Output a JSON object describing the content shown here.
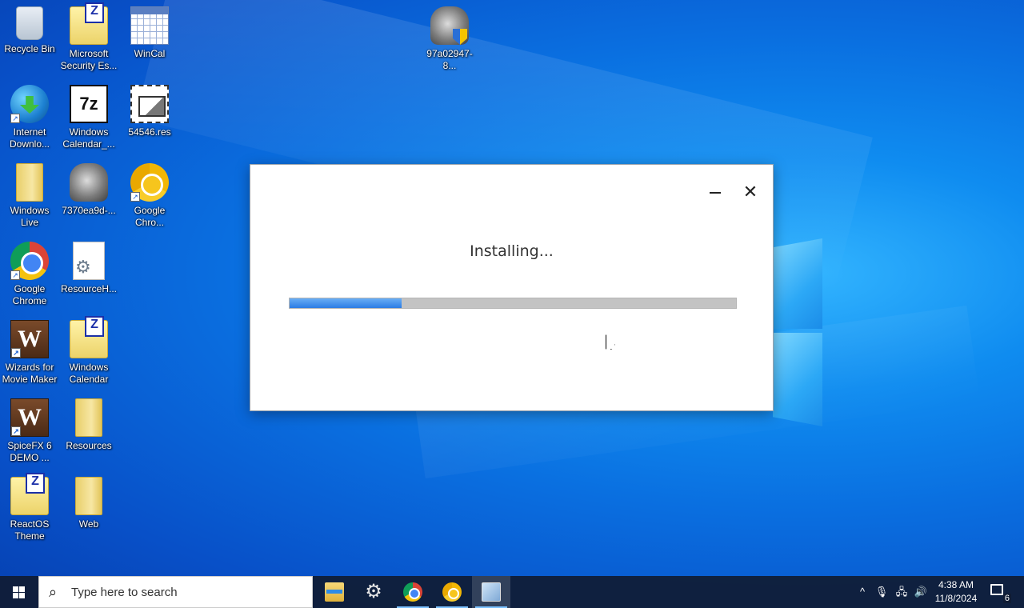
{
  "desktop": {
    "icons": [
      {
        "label": "Recycle Bin"
      },
      {
        "label": "Microsoft Security Es..."
      },
      {
        "label": "WinCal"
      },
      {
        "label": "97a02947-8..."
      },
      {
        "label": "Internet Downlo..."
      },
      {
        "label": "Windows Calendar_..."
      },
      {
        "label": "54546.res"
      },
      {
        "label": "Windows Live"
      },
      {
        "label": "7370ea9d-..."
      },
      {
        "label": "Google Chro..."
      },
      {
        "label": "Google Chrome"
      },
      {
        "label": "ResourceH..."
      },
      {
        "label": "Wizards for Movie Maker"
      },
      {
        "label": "Windows Calendar"
      },
      {
        "label": "SpiceFX 6 DEMO ..."
      },
      {
        "label": "Resources"
      },
      {
        "label": "ReactOS Theme"
      },
      {
        "label": "Web"
      }
    ]
  },
  "installer": {
    "status_text": "Installing...",
    "progress_fraction": 0.25,
    "close_glyph": "✕",
    "accent_color": "#2b7be4"
  },
  "taskbar": {
    "search_placeholder": "Type here to search",
    "search_glyph": "⌕",
    "gear_glyph": "⚙",
    "tray_chevron": "^",
    "tray_mic": "🎙",
    "tray_network": "🖧",
    "tray_volume": "🔊",
    "time": "4:38 AM",
    "date": "11/8/2024",
    "notification_count": "6"
  }
}
